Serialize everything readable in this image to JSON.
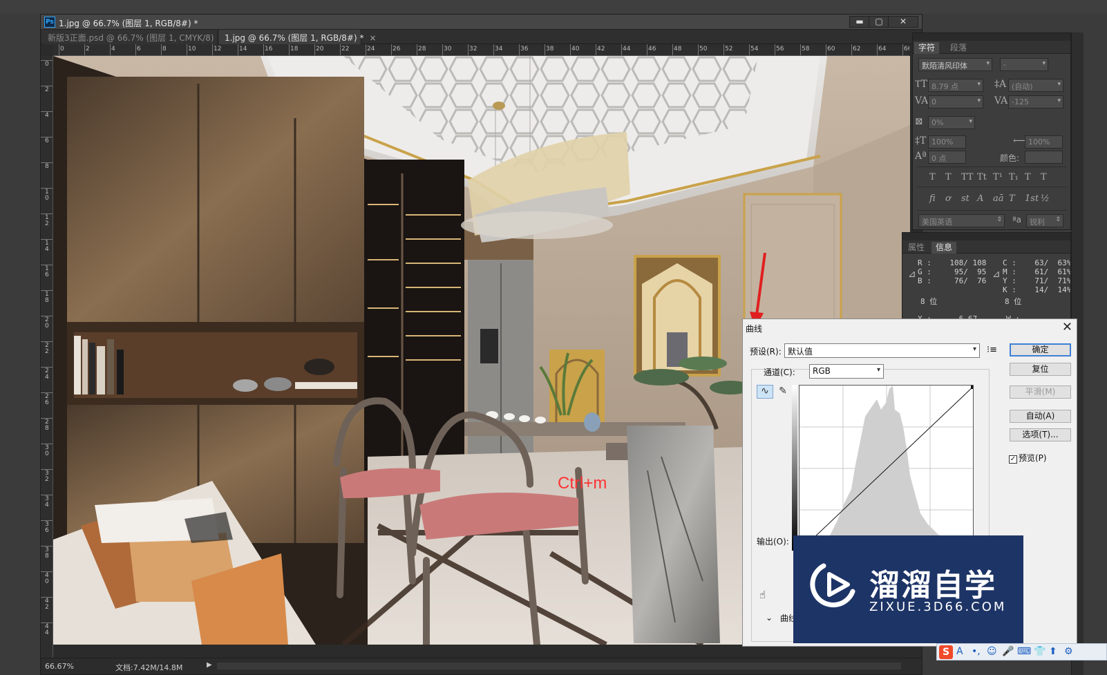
{
  "window": {
    "title": "1.jpg @ 66.7% (图层 1, RGB/8#) *",
    "controls": {
      "minimize": "▬",
      "maximize": "▢",
      "close": "✕"
    }
  },
  "tabs": [
    {
      "label": "新版3正面.psd @ 66.7% (图层 1, CMYK/8)",
      "close": "×",
      "active": false
    },
    {
      "label": "1.jpg @ 66.7% (图层 1, RGB/8#) *",
      "close": "×",
      "active": true
    }
  ],
  "ruler": {
    "h_ticks": [
      "0",
      "2",
      "4",
      "6",
      "8",
      "10",
      "12",
      "14",
      "16",
      "18",
      "20",
      "22",
      "24",
      "26",
      "28",
      "30",
      "32",
      "34",
      "36",
      "38",
      "40",
      "42",
      "44",
      "46",
      "48",
      "50",
      "52",
      "54",
      "56",
      "58",
      "60",
      "62",
      "64",
      "66"
    ],
    "v_ticks": [
      "0",
      "2",
      "4",
      "6",
      "8",
      "10",
      "12",
      "14",
      "16",
      "18",
      "20",
      "22",
      "24",
      "26",
      "28",
      "30",
      "32",
      "34",
      "36",
      "38",
      "40",
      "42",
      "44"
    ]
  },
  "canvas": {
    "annotation": "Ctrl+m"
  },
  "status": {
    "zoom": "66.67%",
    "doc_info": "文档:7.42M/14.8M",
    "arrow": "▶"
  },
  "character_panel": {
    "tabs": [
      "字符",
      "段落"
    ],
    "font_family": "默陌清风印体",
    "font_style": "-",
    "font_size": "8.79 点",
    "leading": "(自动)",
    "kerning": "0",
    "tracking": "-125",
    "tsume": "0%",
    "vscale": "100%",
    "hscale": "100%",
    "baseline": "0 点",
    "color_label": "颜色:",
    "style_buttons": [
      "T",
      "T",
      "TT",
      "Tt",
      "T¹",
      "T₁",
      "T",
      "T"
    ],
    "opentype_buttons": [
      "fi",
      "ơ",
      "st",
      "A",
      "aā",
      "T",
      "1st",
      "½"
    ],
    "language": "美国英语",
    "aa_icon": "ªa",
    "antialias": "锐利"
  },
  "info_panel": {
    "tabs": [
      "属性",
      "信息"
    ],
    "rgb": "R :    108/ 108\nG :     95/  95\nB :     76/  76",
    "cmyk": "C :    63/  63%\nM :    61/  61%\nY :    71/  71%\nK :    14/  14%",
    "bits_left": "8 位",
    "bits_right": "8 位",
    "x_label": "X :      6.67",
    "w_label": "W :"
  },
  "curves_dialog": {
    "title": "曲线",
    "close": "✕",
    "preset_label": "预设(R):",
    "preset_value": "默认值",
    "channel_label": "通道(C):",
    "channel_value": "RGB",
    "output_label": "输出(O):",
    "expand_label": "曲线",
    "buttons": {
      "ok": "确定",
      "reset": "复位",
      "smooth": "平滑(M)",
      "auto": "自动(A)",
      "options": "选项(T)..."
    },
    "preview_label": "预览(P)",
    "preview_checked": true
  },
  "watermark": {
    "brand": "溜溜自学",
    "url": "ZIXUE.3D66.COM"
  },
  "tray": {
    "icons": [
      "S",
      "A",
      "•,",
      "☺",
      "🎤",
      "⌨",
      "👕",
      "⬆",
      "⚙"
    ]
  }
}
